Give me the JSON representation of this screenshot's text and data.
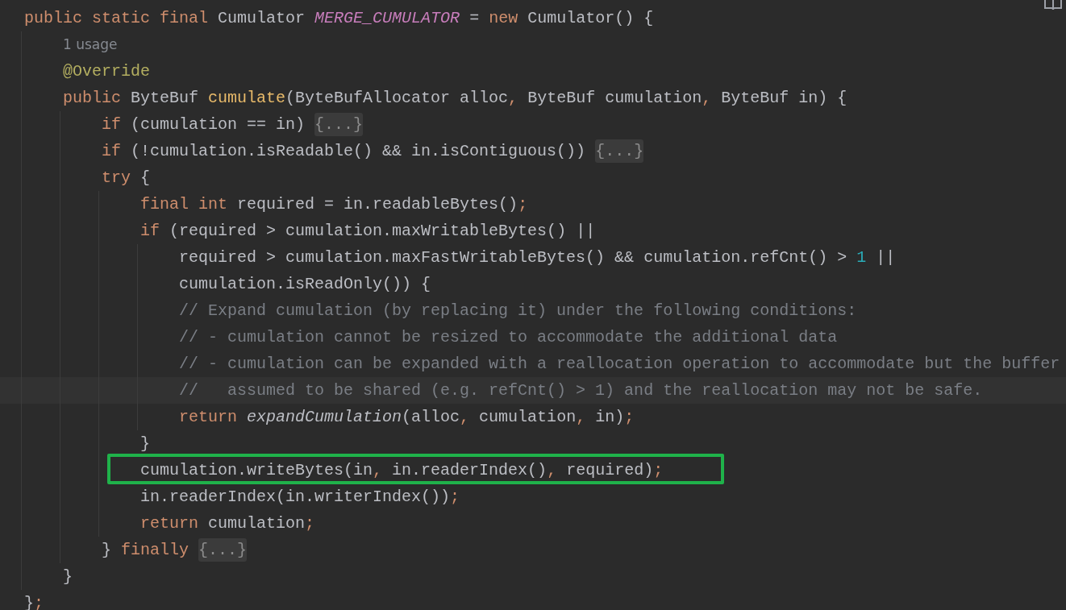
{
  "editor": {
    "lines": [
      {
        "current": false,
        "boxed": false,
        "tokens": [
          {
            "kind": "keyword",
            "text": "public static final "
          },
          {
            "kind": "plain",
            "text": "Cumulator "
          },
          {
            "kind": "static-field",
            "text": "MERGE_CUMULATOR"
          },
          {
            "kind": "plain",
            "text": " = "
          },
          {
            "kind": "keyword",
            "text": "new "
          },
          {
            "kind": "plain",
            "text": "Cumulator() {"
          }
        ]
      },
      {
        "current": false,
        "boxed": false,
        "tokens": [
          {
            "kind": "hint",
            "text": "    1 usage"
          }
        ]
      },
      {
        "current": false,
        "boxed": false,
        "tokens": [
          {
            "kind": "annotation",
            "text": "    @Override"
          }
        ]
      },
      {
        "current": false,
        "boxed": false,
        "tokens": [
          {
            "kind": "keyword",
            "text": "    public "
          },
          {
            "kind": "plain",
            "text": "ByteBuf "
          },
          {
            "kind": "method-decl",
            "text": "cumulate"
          },
          {
            "kind": "plain",
            "text": "(ByteBufAllocator alloc"
          },
          {
            "kind": "punct",
            "text": ", "
          },
          {
            "kind": "plain",
            "text": "ByteBuf cumulation"
          },
          {
            "kind": "punct",
            "text": ", "
          },
          {
            "kind": "plain",
            "text": "ByteBuf in) {"
          }
        ]
      },
      {
        "current": false,
        "boxed": false,
        "tokens": [
          {
            "kind": "keyword",
            "text": "        if "
          },
          {
            "kind": "plain",
            "text": "(cumulation == in) "
          },
          {
            "kind": "fold",
            "text": "{...}"
          }
        ]
      },
      {
        "current": false,
        "boxed": false,
        "tokens": [
          {
            "kind": "keyword",
            "text": "        if "
          },
          {
            "kind": "plain",
            "text": "(!cumulation.isReadable() && in.isContiguous()) "
          },
          {
            "kind": "fold",
            "text": "{...}"
          }
        ]
      },
      {
        "current": false,
        "boxed": false,
        "tokens": [
          {
            "kind": "keyword",
            "text": "        try "
          },
          {
            "kind": "plain",
            "text": "{"
          }
        ]
      },
      {
        "current": false,
        "boxed": false,
        "tokens": [
          {
            "kind": "keyword",
            "text": "            final int "
          },
          {
            "kind": "plain",
            "text": "required = in.readableBytes()"
          },
          {
            "kind": "punct",
            "text": ";"
          }
        ]
      },
      {
        "current": false,
        "boxed": false,
        "tokens": [
          {
            "kind": "keyword",
            "text": "            if "
          },
          {
            "kind": "plain",
            "text": "(required > cumulation.maxWritableBytes() ||"
          }
        ]
      },
      {
        "current": false,
        "boxed": false,
        "tokens": [
          {
            "kind": "plain",
            "text": "                required > cumulation.maxFastWritableBytes() && cumulation.refCnt() > "
          },
          {
            "kind": "number",
            "text": "1"
          },
          {
            "kind": "plain",
            "text": " ||"
          }
        ]
      },
      {
        "current": false,
        "boxed": false,
        "tokens": [
          {
            "kind": "plain",
            "text": "                cumulation.isReadOnly()) {"
          }
        ]
      },
      {
        "current": false,
        "boxed": false,
        "tokens": [
          {
            "kind": "comment",
            "text": "                // Expand cumulation (by replacing it) under the following conditions:"
          }
        ]
      },
      {
        "current": false,
        "boxed": false,
        "tokens": [
          {
            "kind": "comment",
            "text": "                // - cumulation cannot be resized to accommodate the additional data"
          }
        ]
      },
      {
        "current": false,
        "boxed": false,
        "tokens": [
          {
            "kind": "comment",
            "text": "                // - cumulation can be expanded with a reallocation operation to accommodate but the buffer"
          }
        ]
      },
      {
        "current": true,
        "boxed": false,
        "tokens": [
          {
            "kind": "comment",
            "text": "                //   assumed to be shared (e.g. refCnt() > 1) and the reallocation may not be safe."
          }
        ]
      },
      {
        "current": false,
        "boxed": false,
        "tokens": [
          {
            "kind": "keyword",
            "text": "                return "
          },
          {
            "kind": "static-call",
            "text": "expandCumulation"
          },
          {
            "kind": "plain",
            "text": "(alloc"
          },
          {
            "kind": "punct",
            "text": ", "
          },
          {
            "kind": "plain",
            "text": "cumulation"
          },
          {
            "kind": "punct",
            "text": ", "
          },
          {
            "kind": "plain",
            "text": "in)"
          },
          {
            "kind": "punct",
            "text": ";"
          }
        ]
      },
      {
        "current": false,
        "boxed": false,
        "tokens": [
          {
            "kind": "plain",
            "text": "            }"
          }
        ]
      },
      {
        "current": false,
        "boxed": true,
        "tokens": [
          {
            "kind": "plain",
            "text": "            cumulation.writeBytes(in"
          },
          {
            "kind": "punct",
            "text": ", "
          },
          {
            "kind": "plain",
            "text": "in.readerIndex()"
          },
          {
            "kind": "punct",
            "text": ", "
          },
          {
            "kind": "plain",
            "text": "required)"
          },
          {
            "kind": "punct",
            "text": ";"
          }
        ]
      },
      {
        "current": false,
        "boxed": false,
        "tokens": [
          {
            "kind": "plain",
            "text": "            in.readerIndex(in.writerIndex())"
          },
          {
            "kind": "punct",
            "text": ";"
          }
        ]
      },
      {
        "current": false,
        "boxed": false,
        "tokens": [
          {
            "kind": "keyword",
            "text": "            return "
          },
          {
            "kind": "plain",
            "text": "cumulation"
          },
          {
            "kind": "punct",
            "text": ";"
          }
        ]
      },
      {
        "current": false,
        "boxed": false,
        "tokens": [
          {
            "kind": "plain",
            "text": "        } "
          },
          {
            "kind": "keyword",
            "text": "finally "
          },
          {
            "kind": "fold",
            "text": "{...}"
          }
        ]
      },
      {
        "current": false,
        "boxed": false,
        "tokens": [
          {
            "kind": "plain",
            "text": "    }"
          }
        ]
      },
      {
        "current": false,
        "boxed": false,
        "tokens": [
          {
            "kind": "plain",
            "text": "}"
          },
          {
            "kind": "punct",
            "text": ";"
          }
        ]
      }
    ]
  }
}
